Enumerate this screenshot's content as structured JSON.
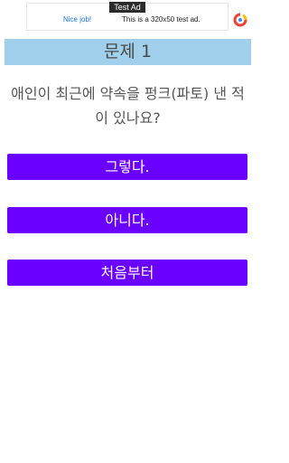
{
  "ad": {
    "badge": "Test Ad",
    "nice_job": "Nice job!",
    "text": "This is a 320x50 test ad.",
    "logo_icon": "adchoices-icon"
  },
  "quiz": {
    "title": "문제 1",
    "question": "애인이 최근에 약속을 펑크(파토) 낸 적이 있나요?",
    "answers": {
      "yes": "그렇다.",
      "no": "아니다.",
      "restart": "처음부터"
    }
  },
  "colors": {
    "title_bg": "#a0d0ec",
    "button_bg": "#6a00ff",
    "button_text": "#ffffff",
    "text": "#555555"
  }
}
